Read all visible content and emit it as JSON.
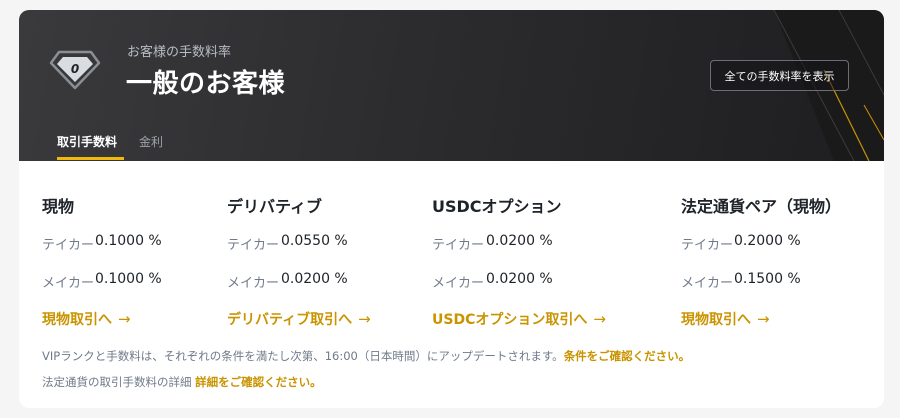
{
  "header": {
    "subtitle": "お客様の手数料率",
    "title": "一般のお客様",
    "badge_level": "0",
    "view_all_button": "全ての手数料率を表示"
  },
  "tabs": [
    {
      "label": "取引手数料",
      "active": true
    },
    {
      "label": "金利",
      "active": false
    }
  ],
  "columns": [
    {
      "title": "現物",
      "taker_label": "テイカー",
      "taker_value": "0.1000 %",
      "maker_label": "メイカー",
      "maker_value": "0.1000 %",
      "link": "現物取引へ"
    },
    {
      "title": "デリバティブ",
      "taker_label": "テイカー",
      "taker_value": "0.0550 %",
      "maker_label": "メイカー",
      "maker_value": "0.0200 %",
      "link": "デリバティブ取引へ"
    },
    {
      "title": "USDCオプション",
      "taker_label": "テイカー",
      "taker_value": "0.0200 %",
      "maker_label": "メイカー",
      "maker_value": "0.0200 %",
      "link": "USDCオプション取引へ"
    },
    {
      "title": "法定通貨ペア（現物）",
      "taker_label": "テイカー",
      "taker_value": "0.2000 %",
      "maker_label": "メイカー",
      "maker_value": "0.1500 %",
      "link": "現物取引へ"
    }
  ],
  "notes": {
    "line1_text": "VIPランクと手数料は、それぞれの条件を満たし次第、16:00（日本時間）にアップデートされます。",
    "line1_link": "条件をご確認ください。",
    "line2_text": "法定通貨の取引手数料の詳細",
    "line2_link": "詳細をご確認ください。"
  },
  "colors": {
    "accent": "#c99400",
    "tab_underline": "#f0b90b",
    "hero_bg": "#2c2c2e"
  },
  "icons": {
    "badge": "diamond-badge-icon",
    "arrow": "arrow-right-icon"
  }
}
